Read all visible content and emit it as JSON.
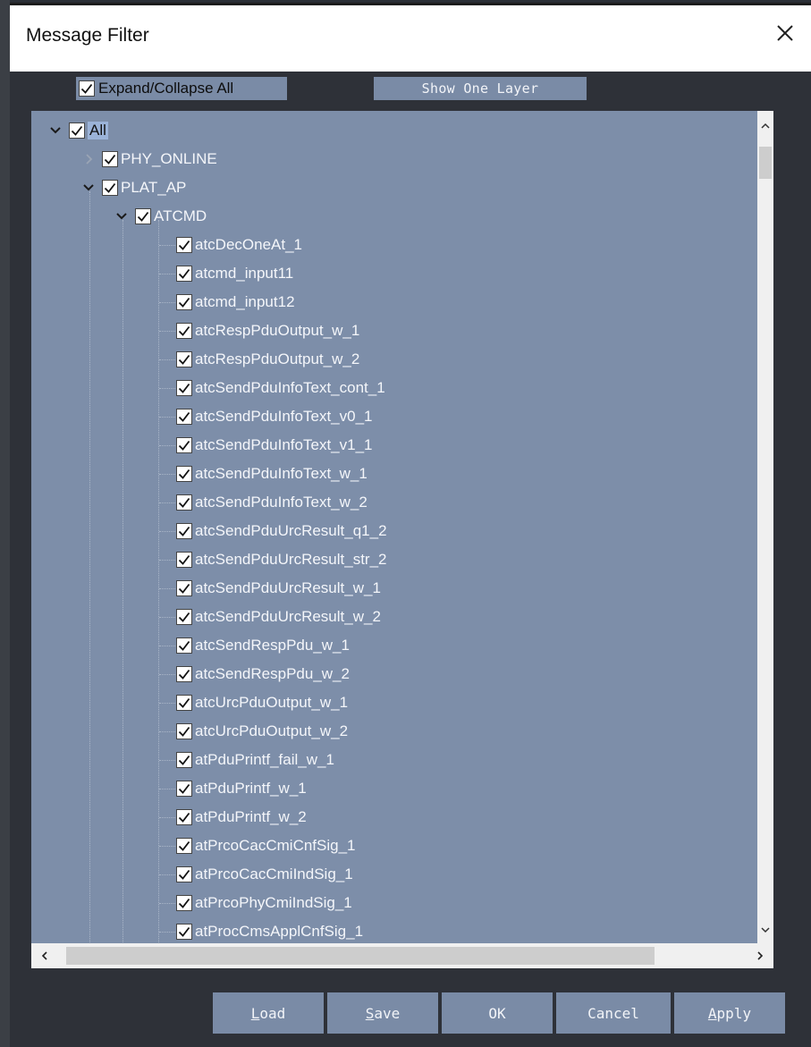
{
  "window": {
    "title": "Message Filter"
  },
  "top": {
    "expand_label": "Expand/Collapse All",
    "expand_checked": true,
    "show_one_layer_label": "Show One Layer"
  },
  "tree": {
    "root": {
      "label": "All",
      "checked": true,
      "expanded": true
    },
    "level1": [
      {
        "label": "PHY_ONLINE",
        "expanded": false,
        "checked": true
      },
      {
        "label": "PLAT_AP",
        "expanded": true,
        "checked": true
      }
    ],
    "level2": {
      "label": "ATCMD",
      "expanded": true,
      "checked": true
    },
    "items": [
      "atcDecOneAt_1",
      "atcmd_input11",
      "atcmd_input12",
      "atcRespPduOutput_w_1",
      "atcRespPduOutput_w_2",
      "atcSendPduInfoText_cont_1",
      "atcSendPduInfoText_v0_1",
      "atcSendPduInfoText_v1_1",
      "atcSendPduInfoText_w_1",
      "atcSendPduInfoText_w_2",
      "atcSendPduUrcResult_q1_2",
      "atcSendPduUrcResult_str_2",
      "atcSendPduUrcResult_w_1",
      "atcSendPduUrcResult_w_2",
      "atcSendRespPdu_w_1",
      "atcSendRespPdu_w_2",
      "atcUrcPduOutput_w_1",
      "atcUrcPduOutput_w_2",
      "atPduPrintf_fail_w_1",
      "atPduPrintf_w_1",
      "atPduPrintf_w_2",
      "atPrcoCacCmiCnfSig_1",
      "atPrcoCacCmiIndSig_1",
      "atPrcoPhyCmiIndSig_1",
      "atProcCmsApplCnfSig_1"
    ]
  },
  "buttons": {
    "load": {
      "pre": "",
      "key": "L",
      "post": "oad"
    },
    "save": {
      "pre": "",
      "key": "S",
      "post": "ave"
    },
    "ok": "OK",
    "cancel": "Cancel",
    "apply": {
      "pre": "",
      "key": "A",
      "post": "pply"
    }
  },
  "colors": {
    "panel": "#7d8ea9",
    "button": "#7a8ba6",
    "background": "#2e3138",
    "selection": "#9bb3d8"
  },
  "icons": [
    "close-icon",
    "chevron-down-icon",
    "chevron-right-icon",
    "checkbox-checked-icon",
    "scroll-up-icon",
    "scroll-down-icon",
    "scroll-left-icon",
    "scroll-right-icon"
  ]
}
